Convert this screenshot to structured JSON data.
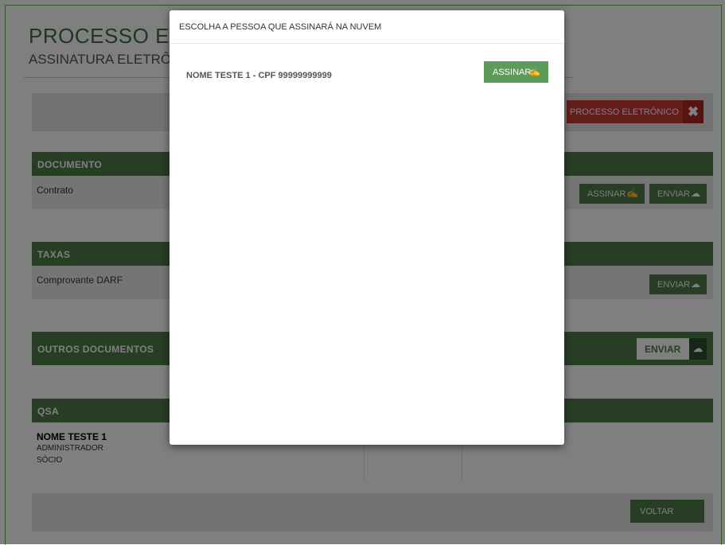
{
  "header": {
    "title": "PROCESSO ELETRÔNICO",
    "subtitle": "ASSINATURA ELETRÔNICA"
  },
  "top_actions": {
    "process_button": "PROCESSO ELETRÔNICO",
    "close_glyph": "✖"
  },
  "documento": {
    "heading": "DOCUMENTO",
    "item": "Contrato",
    "sign_button": "ASSINAR",
    "send_button": "ENVIAR"
  },
  "taxas": {
    "heading": "TAXAS",
    "item": "Comprovante DARF",
    "send_button": "ENVIAR"
  },
  "outros": {
    "heading": "OUTROS DOCUMENTOS",
    "send_button": "ENVIAR"
  },
  "qsa": {
    "heading": "QSA",
    "name": "NOME TESTE 1",
    "role1": "ADMINISTRADOR",
    "role2": "SÓCIO"
  },
  "footer": {
    "back_button": "VOLTAR"
  },
  "modal": {
    "title": "ESCOLHA A PESSOA QUE ASSINARÁ NA NUVEM",
    "person": "NOME TESTE 1 - CPF 99999999999",
    "sign_button": "ASSINAR"
  },
  "icons": {
    "sign": "sign-check-icon",
    "upload": "cloud-upload-icon",
    "close": "close-icon"
  },
  "colors": {
    "primary_green": "#4e7d4a",
    "modal_button_green": "#5e9a5a",
    "danger_red": "#c93a35"
  }
}
